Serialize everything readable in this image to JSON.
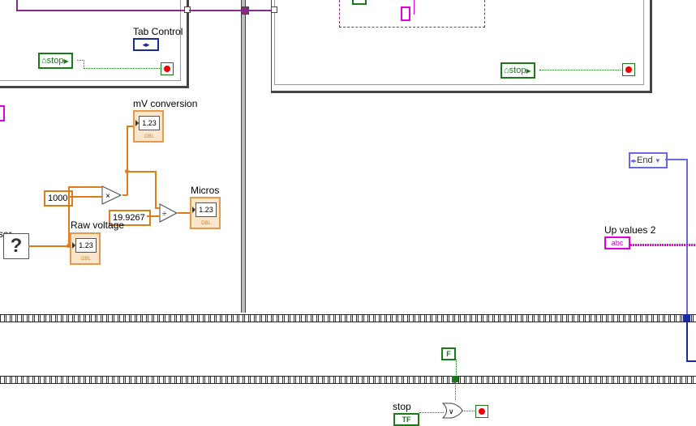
{
  "labels": {
    "tab_control": "Tab Control",
    "mv_conversion": "mV conversion",
    "micros": "Micros",
    "raw_voltage": "Raw voltage",
    "up_values": "Up values 2",
    "stop": "stop",
    "partial": "ser"
  },
  "constants": {
    "c1000": "1000",
    "c19": "19.9267",
    "false_const": "F",
    "tf": "TF",
    "end_enum": "End",
    "abc": "abc",
    "numeric": "1.23",
    "dbl": "DBL",
    "question": "?"
  },
  "buttons": {
    "stop_left": "stop",
    "stop_right": "stop"
  },
  "colors": {
    "numeric_orange": "#e07b1a",
    "boolean_green": "#1a7a1a",
    "string_pink": "#e000e0",
    "cluster_purple": "#8a2a8a",
    "enum_blue": "#4a4ac8"
  }
}
